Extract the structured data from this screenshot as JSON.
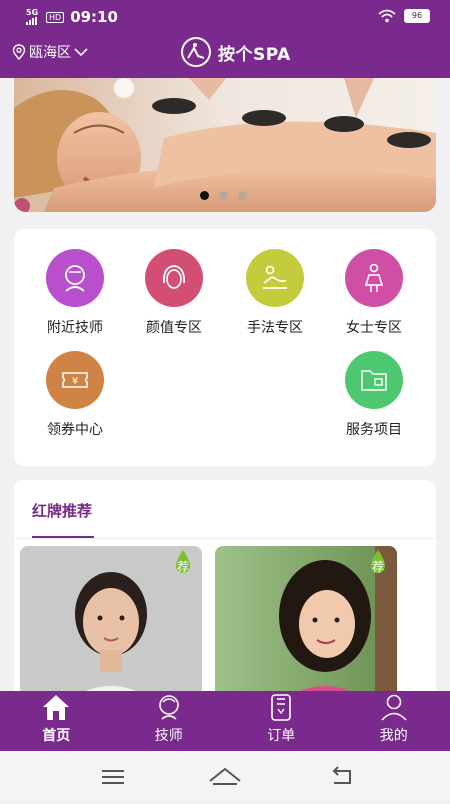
{
  "status_bar": {
    "network": "5G",
    "hd": "HD",
    "time": "09:10",
    "battery": "96"
  },
  "header": {
    "location": "瓯海区",
    "brand": "按个SPA"
  },
  "banner": {
    "dot_count": 3,
    "active_dot": 0
  },
  "menu": {
    "items": [
      {
        "label": "附近技师",
        "icon": "technician-head-icon",
        "color": "#b94fcc"
      },
      {
        "label": "颜值专区",
        "icon": "face-icon",
        "color": "#d24f73"
      },
      {
        "label": "手法专区",
        "icon": "massage-icon",
        "color": "#c4cc3c"
      },
      {
        "label": "女士专区",
        "icon": "woman-icon",
        "color": "#d04fa6"
      },
      {
        "label": "领券中心",
        "icon": "coupon-icon",
        "color": "#cf8446"
      },
      {
        "label": "服务项目",
        "icon": "folder-icon",
        "color": "#4dc870"
      }
    ]
  },
  "recommend": {
    "title": "红牌推荐",
    "tag": "荐"
  },
  "tabbar": {
    "tabs": [
      {
        "label": "首页",
        "icon": "home-icon"
      },
      {
        "label": "技师",
        "icon": "technician-icon"
      },
      {
        "label": "订单",
        "icon": "order-icon"
      },
      {
        "label": "我的",
        "icon": "profile-icon"
      }
    ],
    "active": 0
  },
  "system_nav": {
    "icons": [
      "menu-icon",
      "home-outline-icon",
      "back-icon"
    ]
  }
}
